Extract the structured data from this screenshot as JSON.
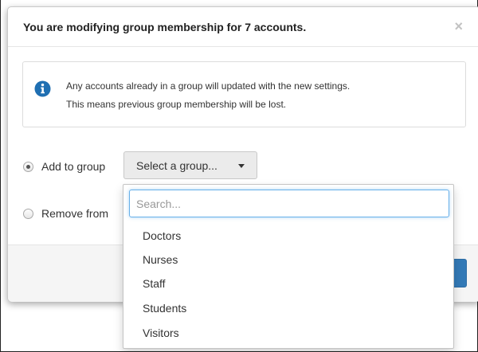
{
  "modal": {
    "title": "You are modifying group membership for 7 accounts.",
    "close_glyph": "×"
  },
  "alert": {
    "icon": "info-circle-icon",
    "line1": "Any accounts already in a group will updated with the new settings.",
    "line2": "This means previous group membership will be lost."
  },
  "options": {
    "add_label": "Add to group",
    "add_selected": true,
    "remove_label": "Remove from",
    "remove_selected": false
  },
  "group_select": {
    "label": "Select a group..."
  },
  "dropdown": {
    "search_placeholder": "Search...",
    "search_value": "",
    "items": [
      "Doctors",
      "Nurses",
      "Staff",
      "Students",
      "Visitors"
    ]
  },
  "colors": {
    "primary": "#337ab7",
    "focus_border": "#66afe9",
    "info_icon": "#1f6fb2"
  }
}
